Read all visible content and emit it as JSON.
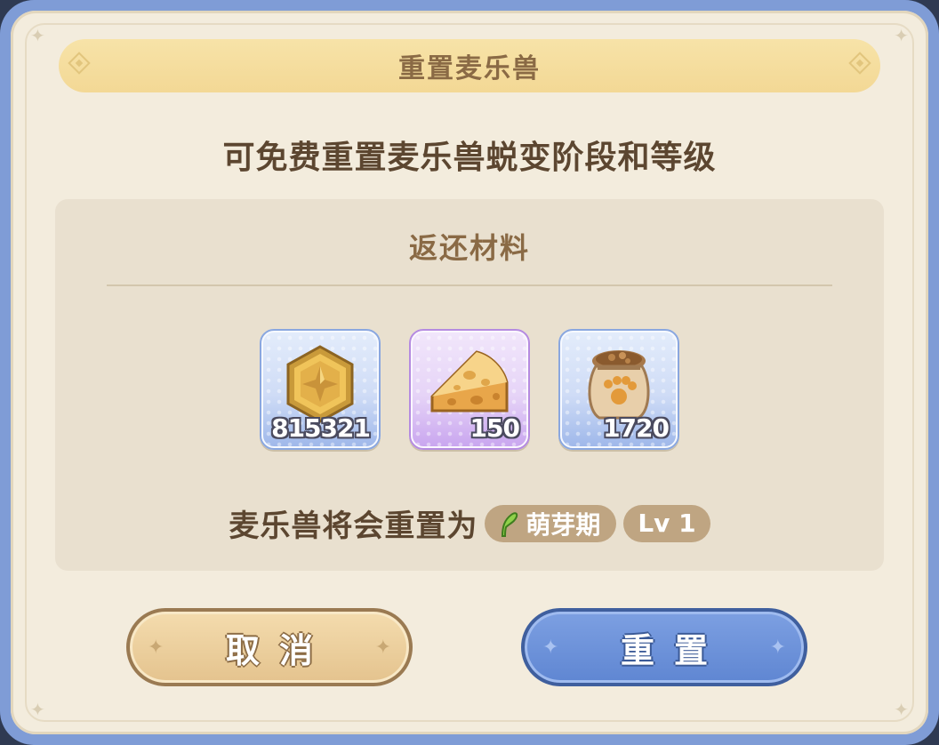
{
  "dialog": {
    "title": "重置麦乐兽",
    "subtitle": "可免费重置麦乐兽蜕变阶段和等级"
  },
  "materials": {
    "title": "返还材料",
    "items": [
      {
        "icon": "gold-coin-icon",
        "count": "815321",
        "rarity_color": "#8aa7df"
      },
      {
        "icon": "cheese-icon",
        "count": "150",
        "rarity_color": "#b58be0"
      },
      {
        "icon": "food-sack-icon",
        "count": "1720",
        "rarity_color": "#8aa7df"
      }
    ]
  },
  "reset_info": {
    "prefix": "麦乐兽将会重置为",
    "stage_icon": "sprout-icon",
    "stage": "萌芽期",
    "level": "Lv 1"
  },
  "buttons": {
    "cancel_label": "取消",
    "reset_label": "重置"
  },
  "colors": {
    "frame": "#7f9cd6",
    "panel": "#f3ecdd",
    "cancel_button": "#e4c38e",
    "reset_button": "#5f86d2"
  }
}
